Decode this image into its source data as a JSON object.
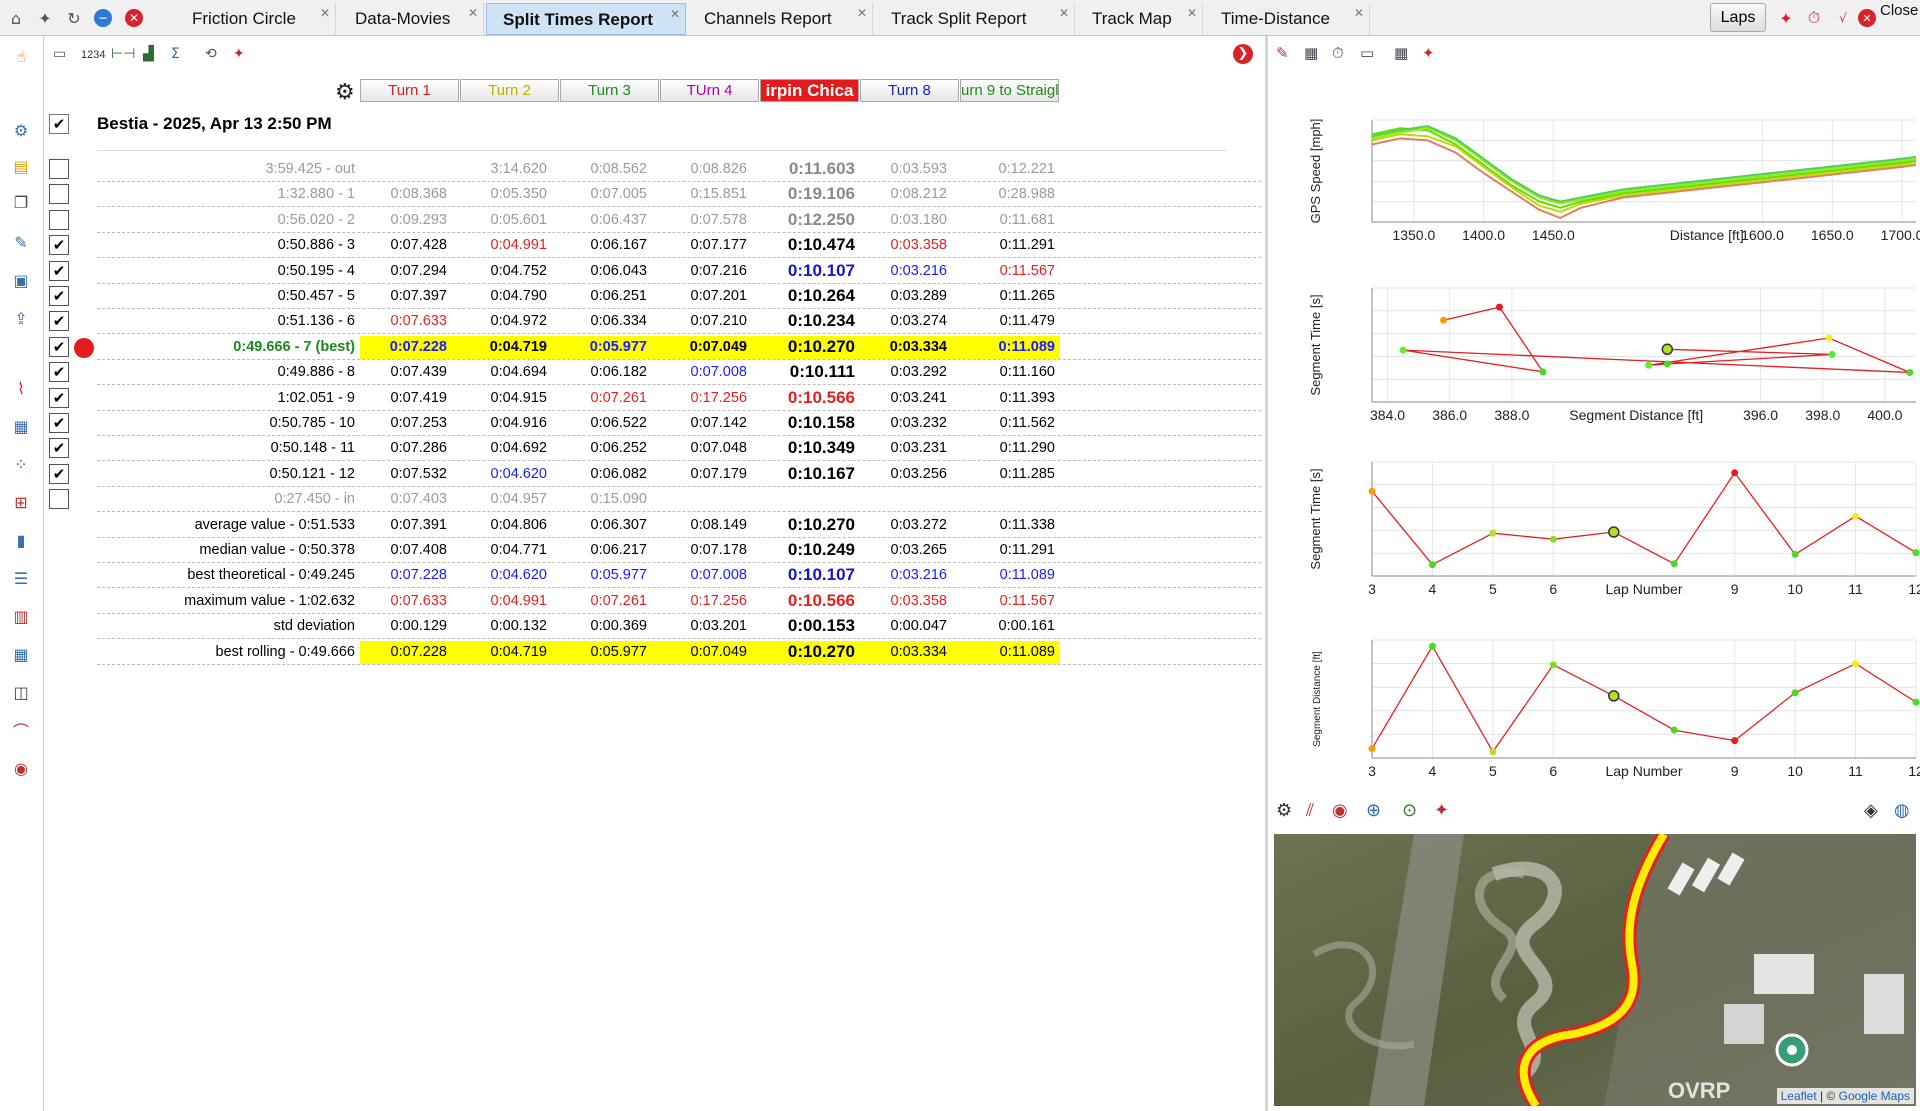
{
  "tabs": [
    {
      "label": "Friction Circle",
      "active": false
    },
    {
      "label": "Data-Movies",
      "active": false
    },
    {
      "label": "Split Times Report",
      "active": true
    },
    {
      "label": "Channels Report",
      "active": false
    },
    {
      "label": "Track Split Report",
      "active": false
    },
    {
      "label": "Track Map",
      "active": false
    },
    {
      "label": "Time-Distance",
      "active": false
    }
  ],
  "toolbar": {
    "laps_label": "Laps",
    "close_label": "Close",
    "counter_label": "1234"
  },
  "report": {
    "session_title": "Bestia - 2025, Apr 13 2:50 PM",
    "split_headers": [
      {
        "label": "Turn 1",
        "color": "#d42020"
      },
      {
        "label": "Turn 2",
        "color": "#b8b000"
      },
      {
        "label": "Turn 3",
        "color": "#1a8a1a"
      },
      {
        "label": "TUrn 4",
        "color": "#b000b0"
      },
      {
        "label": "irpin Chica",
        "color": "#ffffff",
        "selected": true
      },
      {
        "label": "Turn 8",
        "color": "#1a1ad0"
      },
      {
        "label": "urn 9 to Straigl",
        "color": "#1a8a1a"
      }
    ],
    "laps": [
      {
        "label": "3:59.425 - out",
        "checked": false,
        "style": "grey",
        "splits": [
          "",
          "3:14.620",
          "0:08.562",
          "0:08.826",
          "0:11.603",
          "0:03.593",
          "0:12.221"
        ],
        "colors": [
          "",
          "",
          "",
          "",
          "",
          "",
          ""
        ]
      },
      {
        "label": "1:32.880 - 1",
        "checked": false,
        "style": "grey",
        "splits": [
          "0:08.368",
          "0:05.350",
          "0:07.005",
          "0:15.851",
          "0:19.106",
          "0:08.212",
          "0:28.988"
        ],
        "colors": [
          "",
          "",
          "",
          "",
          "",
          "",
          ""
        ]
      },
      {
        "label": "0:56.020 - 2",
        "checked": false,
        "style": "grey",
        "splits": [
          "0:09.293",
          "0:05.601",
          "0:06.437",
          "0:07.578",
          "0:12.250",
          "0:03.180",
          "0:11.681"
        ],
        "colors": [
          "",
          "",
          "",
          "",
          "",
          "",
          ""
        ]
      },
      {
        "label": "0:50.886 - 3",
        "checked": true,
        "style": "",
        "splits": [
          "0:07.428",
          "0:04.991",
          "0:06.167",
          "0:07.177",
          "0:10.474",
          "0:03.358",
          "0:11.291"
        ],
        "colors": [
          "",
          "red",
          "",
          "",
          "",
          "red",
          ""
        ]
      },
      {
        "label": "0:50.195 - 4",
        "checked": true,
        "style": "",
        "splits": [
          "0:07.294",
          "0:04.752",
          "0:06.043",
          "0:07.216",
          "0:10.107",
          "0:03.216",
          "0:11.567"
        ],
        "colors": [
          "",
          "",
          "",
          "",
          "blue",
          "blue",
          "red"
        ]
      },
      {
        "label": "0:50.457 - 5",
        "checked": true,
        "style": "",
        "splits": [
          "0:07.397",
          "0:04.790",
          "0:06.251",
          "0:07.201",
          "0:10.264",
          "0:03.289",
          "0:11.265"
        ],
        "colors": [
          "",
          "",
          "",
          "",
          "",
          "",
          ""
        ]
      },
      {
        "label": "0:51.136 - 6",
        "checked": true,
        "style": "",
        "splits": [
          "0:07.633",
          "0:04.972",
          "0:06.334",
          "0:07.210",
          "0:10.234",
          "0:03.274",
          "0:11.479"
        ],
        "colors": [
          "red",
          "",
          "",
          "",
          "",
          "",
          ""
        ]
      },
      {
        "label": "0:49.666 - 7 (best)",
        "checked": true,
        "style": "best",
        "splits": [
          "0:07.228",
          "0:04.719",
          "0:05.977",
          "0:07.049",
          "0:10.270",
          "0:03.334",
          "0:11.089"
        ],
        "colors": [
          "blue",
          "",
          "blue",
          "",
          "",
          "",
          "blue"
        ]
      },
      {
        "label": "0:49.886 - 8",
        "checked": true,
        "style": "",
        "splits": [
          "0:07.439",
          "0:04.694",
          "0:06.182",
          "0:07.008",
          "0:10.111",
          "0:03.292",
          "0:11.160"
        ],
        "colors": [
          "",
          "",
          "",
          "blue",
          "",
          "",
          ""
        ]
      },
      {
        "label": "1:02.051 - 9",
        "checked": true,
        "style": "",
        "splits": [
          "0:07.419",
          "0:04.915",
          "0:07.261",
          "0:17.256",
          "0:10.566",
          "0:03.241",
          "0:11.393"
        ],
        "colors": [
          "",
          "",
          "red",
          "red",
          "red",
          "",
          ""
        ]
      },
      {
        "label": "0:50.785 - 10",
        "checked": true,
        "style": "",
        "splits": [
          "0:07.253",
          "0:04.916",
          "0:06.522",
          "0:07.142",
          "0:10.158",
          "0:03.232",
          "0:11.562"
        ],
        "colors": [
          "",
          "",
          "",
          "",
          "",
          "",
          ""
        ]
      },
      {
        "label": "0:50.148 - 11",
        "checked": true,
        "style": "",
        "splits": [
          "0:07.286",
          "0:04.692",
          "0:06.252",
          "0:07.048",
          "0:10.349",
          "0:03.231",
          "0:11.290"
        ],
        "colors": [
          "",
          "",
          "",
          "",
          "",
          "",
          ""
        ]
      },
      {
        "label": "0:50.121 - 12",
        "checked": true,
        "style": "",
        "splits": [
          "0:07.532",
          "0:04.620",
          "0:06.082",
          "0:07.179",
          "0:10.167",
          "0:03.256",
          "0:11.285"
        ],
        "colors": [
          "",
          "blue",
          "",
          "",
          "",
          "",
          ""
        ]
      },
      {
        "label": "0:27.450 - in",
        "checked": false,
        "style": "grey",
        "splits": [
          "0:07.403",
          "0:04.957",
          "0:15.090",
          "",
          "",
          "",
          ""
        ],
        "colors": [
          "",
          "",
          "",
          "",
          "",
          "",
          ""
        ]
      }
    ],
    "stats": [
      {
        "label": "average value - 0:51.533",
        "splits": [
          "0:07.391",
          "0:04.806",
          "0:06.307",
          "0:08.149",
          "0:10.270",
          "0:03.272",
          "0:11.338"
        ],
        "color": ""
      },
      {
        "label": "median value - 0:50.378",
        "splits": [
          "0:07.408",
          "0:04.771",
          "0:06.217",
          "0:07.178",
          "0:10.249",
          "0:03.265",
          "0:11.291"
        ],
        "color": ""
      },
      {
        "label": "best theoretical - 0:49.245",
        "splits": [
          "0:07.228",
          "0:04.620",
          "0:05.977",
          "0:07.008",
          "0:10.107",
          "0:03.216",
          "0:11.089"
        ],
        "color": "blue"
      },
      {
        "label": "maximum value - 1:02.632",
        "splits": [
          "0:07.633",
          "0:04.991",
          "0:07.261",
          "0:17.256",
          "0:10.566",
          "0:03.358",
          "0:11.567"
        ],
        "color": "red"
      },
      {
        "label": "std deviation",
        "splits": [
          "0:00.129",
          "0:00.132",
          "0:00.369",
          "0:03.201",
          "0:00.153",
          "0:00.047",
          "0:00.161"
        ],
        "color": ""
      },
      {
        "label": "best rolling - 0:49.666",
        "splits": [
          "0:07.228",
          "0:04.719",
          "0:05.977",
          "0:07.049",
          "0:10.270",
          "0:03.334",
          "0:11.089"
        ],
        "color": "",
        "highlight": true
      }
    ]
  },
  "chart_data": [
    {
      "type": "line",
      "title": "",
      "ylabel": "GPS Speed [mph]",
      "xlabel": "Distance [ft]",
      "xlim": [
        1320,
        1710
      ],
      "ylim": [
        20,
        70
      ],
      "x_ticks": [
        "1350.0",
        "1400.0",
        "1450.0",
        "1600.0",
        "1650.0",
        "1700.0"
      ],
      "x_tick_values": [
        1350,
        1400,
        1450,
        1600,
        1650,
        1700
      ],
      "series": [
        {
          "color": "#66dd00",
          "x": [
            1320,
            1340,
            1360,
            1380,
            1400,
            1420,
            1440,
            1455,
            1470,
            1500,
            1540,
            1580,
            1620,
            1660,
            1700,
            1710
          ],
          "y": [
            63,
            66,
            65,
            58,
            48,
            38,
            30,
            27,
            30,
            34,
            37,
            40,
            43,
            46,
            49,
            50
          ]
        },
        {
          "color": "#88ee22",
          "x": [
            1320,
            1340,
            1360,
            1380,
            1400,
            1420,
            1440,
            1455,
            1470,
            1500,
            1540,
            1580,
            1620,
            1660,
            1700,
            1710
          ],
          "y": [
            61,
            64,
            66,
            60,
            50,
            40,
            32,
            29,
            31,
            35,
            38,
            41,
            44,
            47,
            50,
            51
          ]
        },
        {
          "color": "#bbdd00",
          "x": [
            1320,
            1340,
            1360,
            1380,
            1400,
            1420,
            1440,
            1455,
            1470,
            1500,
            1540,
            1580,
            1620,
            1660,
            1700,
            1710
          ],
          "y": [
            60,
            63,
            62,
            57,
            47,
            37,
            28,
            25,
            29,
            33,
            36,
            39,
            42,
            45,
            48,
            49
          ]
        },
        {
          "color": "#e08060",
          "x": [
            1320,
            1340,
            1360,
            1380,
            1400,
            1420,
            1440,
            1455,
            1470,
            1500,
            1540,
            1580,
            1620,
            1660,
            1700,
            1710
          ],
          "y": [
            58,
            61,
            60,
            54,
            44,
            35,
            26,
            22,
            27,
            32,
            35,
            38,
            41,
            44,
            47,
            48
          ]
        },
        {
          "color": "#55cc55",
          "x": [
            1320,
            1340,
            1360,
            1380,
            1400,
            1420,
            1440,
            1455,
            1470,
            1500,
            1540,
            1580,
            1620,
            1660,
            1700,
            1710
          ],
          "y": [
            62,
            65,
            67,
            61,
            51,
            41,
            33,
            30,
            32,
            36,
            39,
            42,
            45,
            48,
            51,
            52
          ]
        }
      ]
    },
    {
      "type": "scatter",
      "title": "",
      "ylabel": "Segment Time [s]",
      "xlabel": "Segment Distance [ft]",
      "xlim": [
        383.5,
        401
      ],
      "ylim": [
        9.9,
        10.7
      ],
      "x_ticks": [
        "384.0",
        "386.0",
        "388.0",
        "396.0",
        "398.0",
        "400.0"
      ],
      "x_tick_values": [
        384,
        386,
        388,
        396,
        398,
        400
      ],
      "points": [
        {
          "x": 385.8,
          "y": 10.474,
          "color": "#ff9900"
        },
        {
          "x": 387.6,
          "y": 10.566,
          "color": "#e32020"
        },
        {
          "x": 389.0,
          "y": 10.111,
          "color": "#44dd22"
        },
        {
          "x": 384.5,
          "y": 10.264,
          "color": "#66ee22"
        },
        {
          "x": 400.8,
          "y": 10.107,
          "color": "#44dd22"
        },
        {
          "x": 398.2,
          "y": 10.349,
          "color": "#eeee22"
        },
        {
          "x": 392.4,
          "y": 10.158,
          "color": "#66ee22"
        },
        {
          "x": 393.0,
          "y": 10.167,
          "color": "#44dd22"
        },
        {
          "x": 398.3,
          "y": 10.234,
          "color": "#55ee22"
        },
        {
          "x": 393.0,
          "y": 10.27,
          "color": "#bbdd22",
          "selected": true
        }
      ]
    },
    {
      "type": "line",
      "title": "",
      "ylabel": "Segment Time [s]",
      "xlabel": "Lap Number",
      "xlim": [
        3,
        12
      ],
      "ylim": [
        10.05,
        10.62
      ],
      "x_ticks": [
        "3",
        "4",
        "5",
        "6",
        "9",
        "10",
        "11",
        "12"
      ],
      "x_tick_values": [
        3,
        4,
        5,
        6,
        9,
        10,
        11,
        12
      ],
      "series": [
        {
          "color": "#e32020",
          "x": [
            3,
            4,
            5,
            6,
            7,
            8,
            9,
            10,
            11,
            12
          ],
          "y": [
            10.474,
            10.107,
            10.264,
            10.234,
            10.27,
            10.111,
            10.566,
            10.158,
            10.349,
            10.167
          ]
        }
      ],
      "point_colors": [
        "#ff9900",
        "#44dd22",
        "#bbdd22",
        "#88dd22",
        "#bbdd22",
        "#44dd22",
        "#e32020",
        "#44dd22",
        "#eeee22",
        "#44dd22"
      ],
      "selected_index": 4
    },
    {
      "type": "line",
      "title": "",
      "ylabel": "Segment Distance [ft]",
      "xlabel": "Lap Number",
      "xlim": [
        3,
        12
      ],
      "ylim": [
        383,
        402
      ],
      "x_ticks": [
        "3",
        "4",
        "5",
        "6",
        "9",
        "10",
        "11",
        "12"
      ],
      "x_tick_values": [
        3,
        4,
        5,
        6,
        9,
        10,
        11,
        12
      ],
      "series": [
        {
          "color": "#e32020",
          "x": [
            3,
            4,
            5,
            6,
            7,
            8,
            9,
            10,
            11,
            12
          ],
          "y": [
            384.5,
            401.0,
            384.0,
            398.0,
            393.0,
            387.5,
            385.8,
            393.5,
            398.2,
            392.0
          ]
        }
      ],
      "point_colors": [
        "#ff9900",
        "#44dd22",
        "#bbdd22",
        "#88dd22",
        "#bbdd22",
        "#44dd22",
        "#e32020",
        "#44dd22",
        "#eeee22",
        "#44dd22"
      ],
      "selected_index": 4
    }
  ],
  "map": {
    "attribution_leaflet": "Leaflet",
    "attribution_sep": " | © ",
    "attribution_google": "Google Maps",
    "label": "OVRP",
    "track_color": "#ffee00",
    "track_outline_color": "#e32020"
  }
}
